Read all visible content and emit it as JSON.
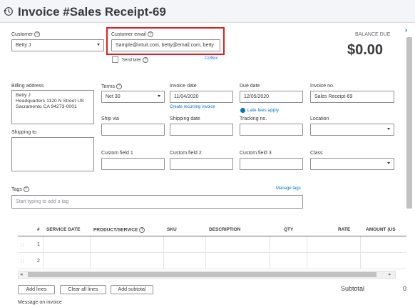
{
  "header": {
    "title": "Invoice #Sales Receipt-69",
    "history_icon": "history-clock-icon"
  },
  "customer": {
    "label": "Customer",
    "value": "Betty J"
  },
  "customer_email": {
    "label": "Customer email",
    "value": "Sample@intuit.com, betty@email.com, betty",
    "send_later": "Send later",
    "cc_bcc": "Cc/Bcc"
  },
  "balance": {
    "label": "BALANCE DUE",
    "amount": "$0.00"
  },
  "billing": {
    "label": "Billing address",
    "line1": "Betty J",
    "line2": "Headquarters 1120 N Street US",
    "line3": "Sacramento CA 94273-0001"
  },
  "terms": {
    "label": "Terms",
    "value": "Net 30"
  },
  "invoice_date": {
    "label": "Invoice date",
    "value": "11/04/2020",
    "recurring_link": "Create recurring invoice"
  },
  "due_date": {
    "label": "Due date",
    "value": "12/05/2020",
    "late_fees": "Late fees apply"
  },
  "invoice_no": {
    "label": "Invoice no.",
    "value": "Sales Receipt-69"
  },
  "ship_via": {
    "label": "Ship via",
    "value": ""
  },
  "shipping_date": {
    "label": "Shipping date",
    "value": ""
  },
  "tracking_no": {
    "label": "Tracking no.",
    "value": ""
  },
  "location": {
    "label": "Location",
    "value": ""
  },
  "shipping_to": {
    "label": "Shipping to",
    "value": ""
  },
  "custom_fields": [
    {
      "label": "Custom field 1",
      "value": ""
    },
    {
      "label": "Custom field 2",
      "value": ""
    },
    {
      "label": "Custom field 3",
      "value": ""
    }
  ],
  "class_field": {
    "label": "Class",
    "value": ""
  },
  "tags": {
    "label": "Tags",
    "placeholder": "Start typing to add a tag",
    "manage_link": "Manage tags"
  },
  "table": {
    "columns": [
      "#",
      "SERVICE DATE",
      "PRODUCT/SERVICE",
      "SKU",
      "DESCRIPTION",
      "QTY",
      "RATE",
      "AMOUNT (US"
    ],
    "rows": [
      "1",
      "2"
    ]
  },
  "buttons": {
    "add_lines": "Add lines",
    "clear_all": "Clear all lines",
    "add_subtotal": "Add subtotal"
  },
  "subtotal": {
    "label": "Subtotal",
    "value": "0"
  },
  "message": {
    "label": "Message on invoice"
  },
  "highlight_color": "#e31c23",
  "accent_color": "#0077c5"
}
